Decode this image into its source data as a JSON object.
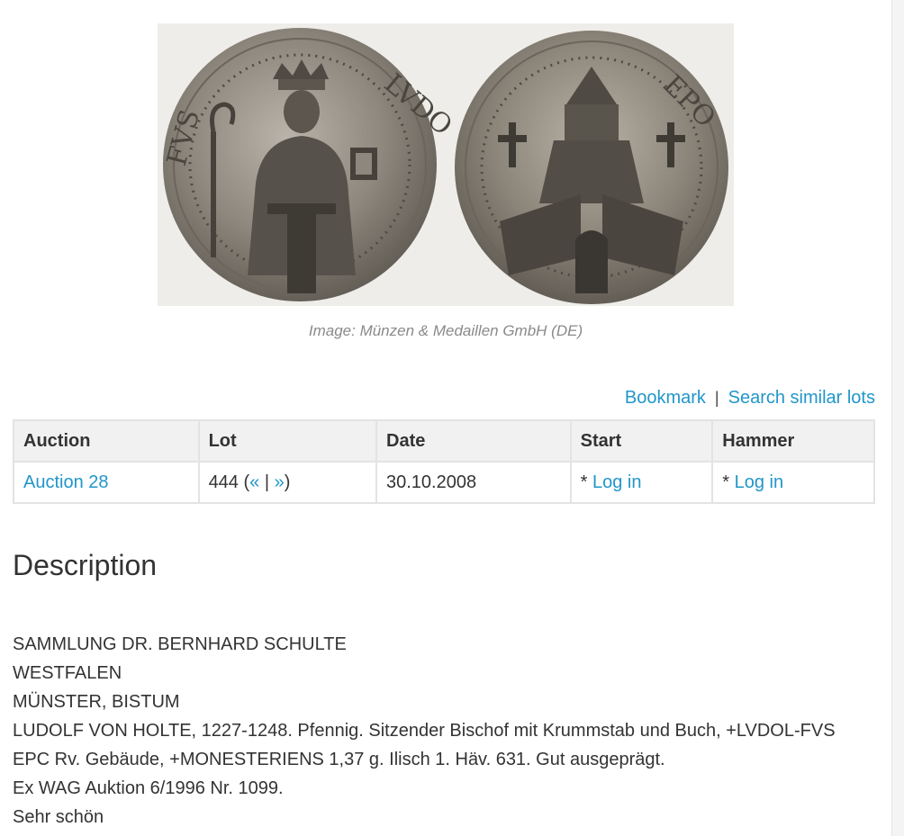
{
  "image": {
    "caption": "Image: Münzen & Medaillen GmbH (DE)"
  },
  "actions": {
    "bookmark": "Bookmark",
    "separator": "|",
    "search_similar": "Search similar lots"
  },
  "table": {
    "headers": [
      "Auction",
      "Lot",
      "Date",
      "Start",
      "Hammer"
    ],
    "row": {
      "auction": "Auction 28",
      "lot_number": "444 (",
      "lot_prev": "«",
      "lot_sep": " | ",
      "lot_next": "»",
      "lot_close": ")",
      "date": "30.10.2008",
      "start_prefix": "* ",
      "start_link": "Log in",
      "hammer_prefix": "* ",
      "hammer_link": "Log in"
    }
  },
  "description": {
    "heading": "Description",
    "lines": [
      "SAMMLUNG DR. BERNHARD SCHULTE",
      "WESTFALEN",
      "MÜNSTER, BISTUM",
      "LUDOLF VON HOLTE, 1227-1248. Pfennig. Sitzender Bischof mit Krummstab und Buch, +LVDOL-FVS",
      "EPC Rv. Gebäude, +MONESTERIENS 1,37 g. Ilisch 1. Häv. 631. Gut ausgeprägt.",
      "Ex WAG Auktion 6/1996 Nr. 1099.",
      "Sehr schön"
    ]
  },
  "colors": {
    "link": "#2196c9",
    "text": "#333333",
    "caption": "#8a8a8a",
    "header_bg": "#f1f1f1",
    "border": "#e3e3e3"
  }
}
